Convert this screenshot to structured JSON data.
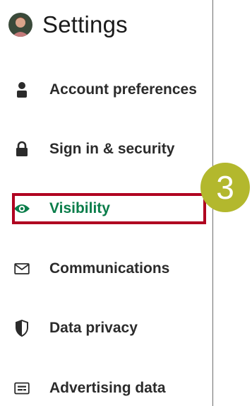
{
  "header": {
    "title": "Settings",
    "avatar_icon": "user-avatar"
  },
  "nav": {
    "items": [
      {
        "label": "Account preferences",
        "icon": "person-icon",
        "active": false
      },
      {
        "label": "Sign in & security",
        "icon": "lock-icon",
        "active": false
      },
      {
        "label": "Visibility",
        "icon": "eye-icon",
        "active": true
      },
      {
        "label": "Communications",
        "icon": "envelope-icon",
        "active": false
      },
      {
        "label": "Data privacy",
        "icon": "shield-icon",
        "active": false
      },
      {
        "label": "Advertising data",
        "icon": "ad-card-icon",
        "active": false
      }
    ]
  },
  "annotation": {
    "step_number": "3"
  },
  "colors": {
    "active_text": "#0a7d4a",
    "highlight_border": "#b00020",
    "badge_fill": "#b3b82d",
    "text": "#2b2b2b"
  }
}
